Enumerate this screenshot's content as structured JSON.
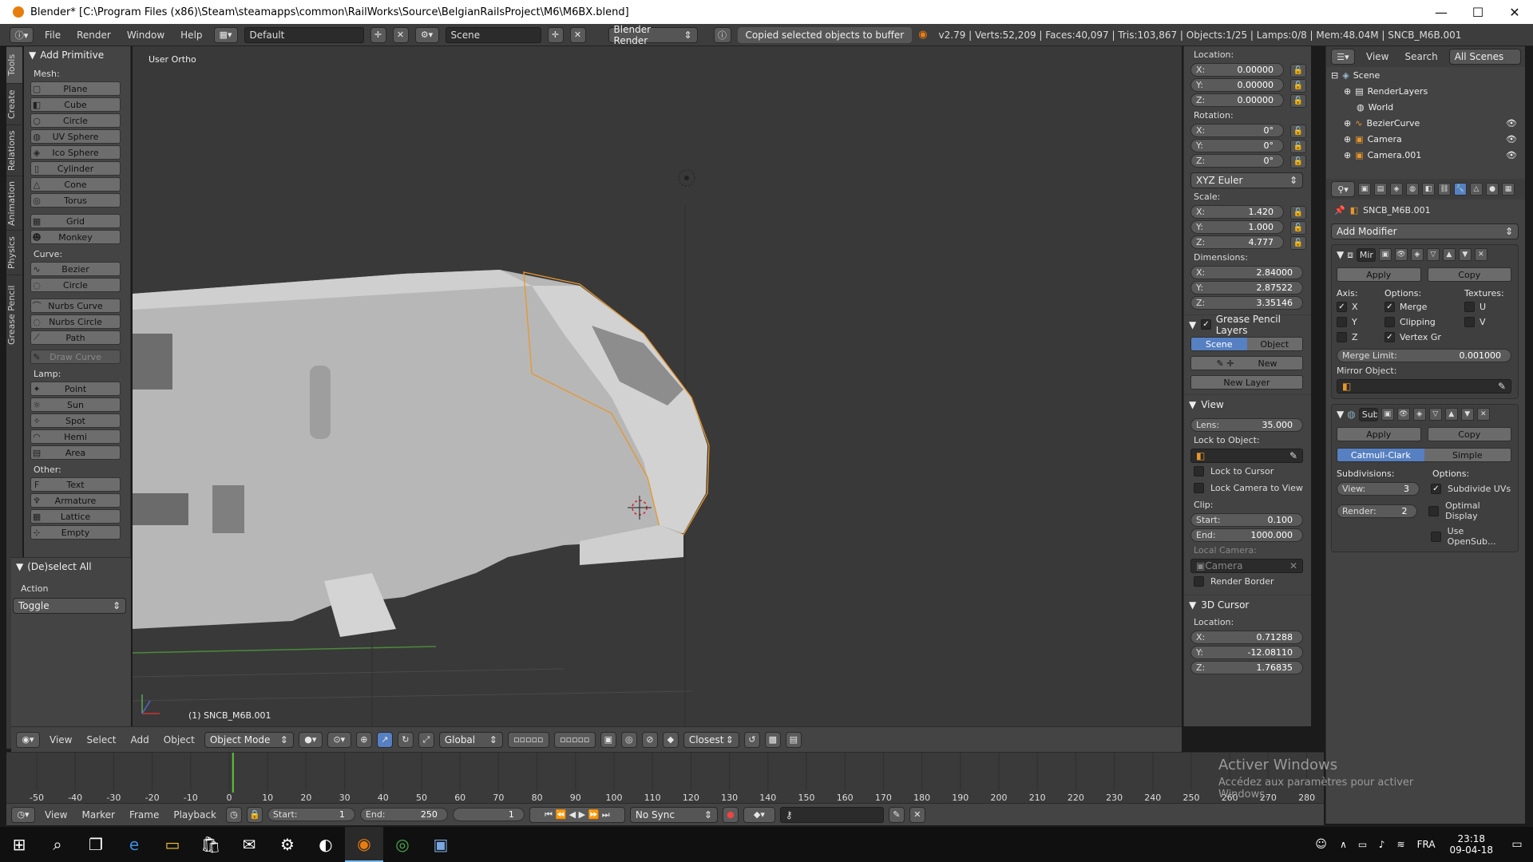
{
  "window": {
    "title": "Blender* [C:\\Program Files (x86)\\Steam\\steamapps\\common\\RailWorks\\Source\\BelgianRailsProject\\M6\\M6BX.blend]",
    "minimize": "—",
    "maximize": "☐",
    "close": "✕"
  },
  "info": {
    "menus": [
      "File",
      "Render",
      "Window",
      "Help"
    ],
    "layout": "Default",
    "scene": "Scene",
    "engine": "Blender Render",
    "message": "Copied selected objects to buffer",
    "stats": "v2.79 | Verts:52,209 | Faces:40,097 | Tris:103,867 | Objects:1/25 | Lamps:0/8 | Mem:48.04M | SNCB_M6B.001"
  },
  "tabs": [
    "Tools",
    "Create",
    "Relations",
    "Animation",
    "Physics",
    "Grease Pencil"
  ],
  "toolshelf": {
    "title": "Add Primitive",
    "mesh_label": "Mesh:",
    "mesh": [
      "Plane",
      "Cube",
      "Circle",
      "UV Sphere",
      "Ico Sphere",
      "Cylinder",
      "Cone",
      "Torus",
      "Grid",
      "Monkey"
    ],
    "curve_label": "Curve:",
    "curve": [
      "Bezier",
      "Circle",
      "Nurbs Curve",
      "Nurbs Circle",
      "Path"
    ],
    "draw_curve": "Draw Curve",
    "lamp_label": "Lamp:",
    "lamp": [
      "Point",
      "Sun",
      "Spot",
      "Hemi",
      "Area"
    ],
    "other_label": "Other:",
    "other": [
      "Text",
      "Armature",
      "Lattice",
      "Empty"
    ]
  },
  "operator": {
    "title": "(De)select All",
    "action_label": "Action",
    "action_value": "Toggle"
  },
  "viewport": {
    "view_name": "User Ortho",
    "object_label": "(1) SNCB_M6B.001"
  },
  "vp_header": {
    "menus": [
      "View",
      "Select",
      "Add",
      "Object"
    ],
    "mode": "Object Mode",
    "orientation": "Global",
    "snap": "Closest"
  },
  "npanel": {
    "location_label": "Location:",
    "location": [
      {
        "axis": "X:",
        "value": "0.00000"
      },
      {
        "axis": "Y:",
        "value": "0.00000"
      },
      {
        "axis": "Z:",
        "value": "0.00000"
      }
    ],
    "rotation_label": "Rotation:",
    "rotation": [
      {
        "axis": "X:",
        "value": "0°"
      },
      {
        "axis": "Y:",
        "value": "0°"
      },
      {
        "axis": "Z:",
        "value": "0°"
      }
    ],
    "rotation_mode": "XYZ Euler",
    "scale_label": "Scale:",
    "scale": [
      {
        "axis": "X:",
        "value": "1.420"
      },
      {
        "axis": "Y:",
        "value": "1.000"
      },
      {
        "axis": "Z:",
        "value": "4.777"
      }
    ],
    "dimensions_label": "Dimensions:",
    "dimensions": [
      {
        "axis": "X:",
        "value": "2.84000"
      },
      {
        "axis": "Y:",
        "value": "2.87522"
      },
      {
        "axis": "Z:",
        "value": "3.35146"
      }
    ],
    "grease_title": "Grease Pencil Layers",
    "grease_scene": "Scene",
    "grease_object": "Object",
    "grease_new": "New",
    "grease_new_layer": "New Layer",
    "view_title": "View",
    "lens": {
      "axis": "Lens:",
      "value": "35.000"
    },
    "lock_object_label": "Lock to Object:",
    "lock_cursor": "Lock to Cursor",
    "lock_camera": "Lock Camera to View",
    "clip_label": "Clip:",
    "clip_start": {
      "axis": "Start:",
      "value": "0.100"
    },
    "clip_end": {
      "axis": "End:",
      "value": "1000.000"
    },
    "local_camera_label": "Local Camera:",
    "local_camera": "Camera",
    "render_border": "Render Border",
    "cursor_title": "3D Cursor",
    "cursor_location_label": "Location:",
    "cursor": [
      {
        "axis": "X:",
        "value": "0.71288"
      },
      {
        "axis": "Y:",
        "value": "-12.08110"
      },
      {
        "axis": "Z:",
        "value": "1.76835"
      }
    ]
  },
  "outliner": {
    "menus": [
      "View",
      "Search"
    ],
    "filter": "All Scenes",
    "items": [
      "Scene",
      "RenderLayers",
      "World",
      "BezierCurve",
      "Camera",
      "Camera.001"
    ]
  },
  "props": {
    "object_name": "SNCB_M6B.001",
    "add_modifier": "Add Modifier",
    "mirror": {
      "name": "Mir",
      "apply": "Apply",
      "copy": "Copy",
      "axis_label": "Axis:",
      "options_label": "Options:",
      "textures_label": "Textures:",
      "x": "X",
      "y": "Y",
      "z": "Z",
      "merge": "Merge",
      "clipping": "Clipping",
      "vertex": "Vertex Gr",
      "u": "U",
      "v": "V",
      "merge_limit_label": "Merge Limit:",
      "merge_limit_value": "0.001000",
      "mirror_object_label": "Mirror Object:"
    },
    "subsurf": {
      "name": "Sub",
      "apply": "Apply",
      "copy": "Copy",
      "catmull": "Catmull-Clark",
      "simple": "Simple",
      "subdivisions_label": "Subdivisions:",
      "options_label": "Options:",
      "view_label": "View:",
      "view_value": "3",
      "render_label": "Render:",
      "render_value": "2",
      "subdivide_uvs": "Subdivide UVs",
      "optimal": "Optimal Display",
      "opensubdiv": "Use OpenSub..."
    }
  },
  "timeline": {
    "ticks": [
      "-50",
      "-40",
      "-30",
      "-20",
      "-10",
      "0",
      "10",
      "20",
      "30",
      "40",
      "50",
      "60",
      "70",
      "80",
      "90",
      "100",
      "110",
      "120",
      "130",
      "140",
      "150",
      "160",
      "170",
      "180",
      "190",
      "200",
      "210",
      "220",
      "230",
      "240",
      "250",
      "260",
      "270",
      "280"
    ],
    "current_frame": 1
  },
  "tl_header": {
    "menus": [
      "View",
      "Marker",
      "Frame",
      "Playback"
    ],
    "start_label": "Start:",
    "start": "1",
    "end_label": "End:",
    "end": "250",
    "current": "1",
    "sync": "No Sync"
  },
  "watermark": {
    "line1": "Activer Windows",
    "line2": "Accédez aux paramètres pour activer Windows."
  },
  "taskbar": {
    "lang": "FRA",
    "time": "23:18",
    "date": "09-04-18"
  },
  "colors": {
    "selection_outline": "#e8962c",
    "active_blue": "#5680c2",
    "frame_marker": "#5ec33a"
  }
}
